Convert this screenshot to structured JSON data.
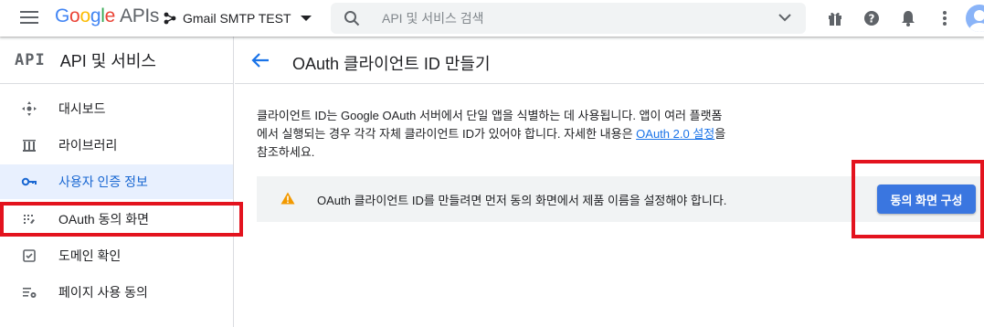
{
  "topbar": {
    "logo": {
      "G": "G",
      "o1": "o",
      "o2": "o",
      "g": "g",
      "l": "l",
      "e": "e",
      "apis": "APIs"
    },
    "project_name": "Gmail SMTP TEST",
    "search": {
      "placeholder": "API 및 서비스 검색",
      "value": ""
    },
    "icons": [
      "menu-icon",
      "gift-icon",
      "help-icon",
      "notifications-icon",
      "more-vert-icon",
      "account-avatar"
    ]
  },
  "sidebar": {
    "mark": "API",
    "title": "API 및 서비스",
    "items": [
      {
        "label": "대시보드",
        "icon": "dashboard-icon"
      },
      {
        "label": "라이브러리",
        "icon": "library-icon"
      },
      {
        "label": "사용자 인증 정보",
        "icon": "key-icon",
        "active": true
      },
      {
        "label": "OAuth 동의 화면",
        "icon": "consent-icon"
      },
      {
        "label": "도메인 확인",
        "icon": "domain-verify-icon"
      },
      {
        "label": "페이지 사용 동의",
        "icon": "page-usage-icon"
      }
    ]
  },
  "main": {
    "title": "OAuth 클라이언트 ID 만들기",
    "description_part1": "클라이언트 ID는 Google OAuth 서버에서 단일 앱을 식별하는 데 사용됩니다. 앱이 여러 플랫폼에서 실행되는 경우 각각 자체 클라이언트 ID가 있어야 합니다. 자세한 내용은 ",
    "description_link": "OAuth 2.0 설정",
    "description_part2": "을 참조하세요.",
    "alert_text": "OAuth 클라이언트 ID를 만들려면 먼저 동의 화면에서 제품 이름을 설정해야 합니다.",
    "consent_button": "동의 화면 구성"
  },
  "colors": {
    "accent": "#1a73e8",
    "button": "#3a76e0",
    "highlight_box": "#e3131e",
    "warning": "#f29900"
  }
}
